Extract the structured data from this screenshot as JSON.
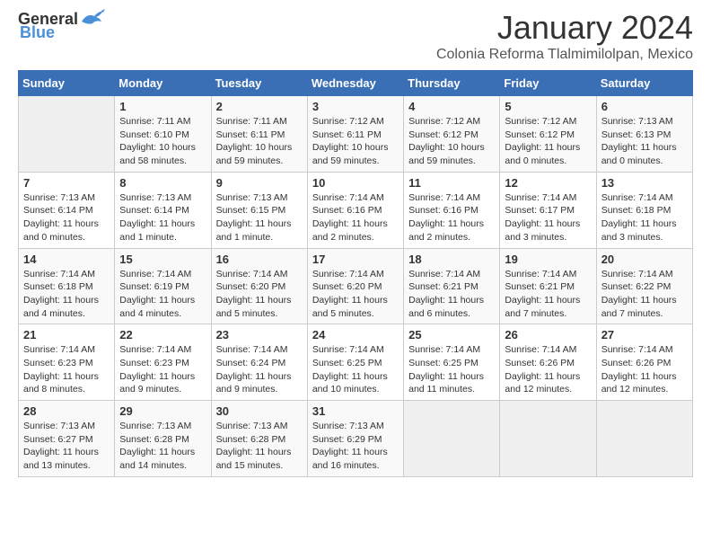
{
  "header": {
    "logo_general": "General",
    "logo_blue": "Blue",
    "title": "January 2024",
    "subtitle": "Colonia Reforma Tlalmimilolpan, Mexico"
  },
  "days_of_week": [
    "Sunday",
    "Monday",
    "Tuesday",
    "Wednesday",
    "Thursday",
    "Friday",
    "Saturday"
  ],
  "weeks": [
    [
      {
        "day": "",
        "info": ""
      },
      {
        "day": "1",
        "info": "Sunrise: 7:11 AM\nSunset: 6:10 PM\nDaylight: 10 hours\nand 58 minutes."
      },
      {
        "day": "2",
        "info": "Sunrise: 7:11 AM\nSunset: 6:11 PM\nDaylight: 10 hours\nand 59 minutes."
      },
      {
        "day": "3",
        "info": "Sunrise: 7:12 AM\nSunset: 6:11 PM\nDaylight: 10 hours\nand 59 minutes."
      },
      {
        "day": "4",
        "info": "Sunrise: 7:12 AM\nSunset: 6:12 PM\nDaylight: 10 hours\nand 59 minutes."
      },
      {
        "day": "5",
        "info": "Sunrise: 7:12 AM\nSunset: 6:12 PM\nDaylight: 11 hours\nand 0 minutes."
      },
      {
        "day": "6",
        "info": "Sunrise: 7:13 AM\nSunset: 6:13 PM\nDaylight: 11 hours\nand 0 minutes."
      }
    ],
    [
      {
        "day": "7",
        "info": "Sunrise: 7:13 AM\nSunset: 6:14 PM\nDaylight: 11 hours\nand 0 minutes."
      },
      {
        "day": "8",
        "info": "Sunrise: 7:13 AM\nSunset: 6:14 PM\nDaylight: 11 hours\nand 1 minute."
      },
      {
        "day": "9",
        "info": "Sunrise: 7:13 AM\nSunset: 6:15 PM\nDaylight: 11 hours\nand 1 minute."
      },
      {
        "day": "10",
        "info": "Sunrise: 7:14 AM\nSunset: 6:16 PM\nDaylight: 11 hours\nand 2 minutes."
      },
      {
        "day": "11",
        "info": "Sunrise: 7:14 AM\nSunset: 6:16 PM\nDaylight: 11 hours\nand 2 minutes."
      },
      {
        "day": "12",
        "info": "Sunrise: 7:14 AM\nSunset: 6:17 PM\nDaylight: 11 hours\nand 3 minutes."
      },
      {
        "day": "13",
        "info": "Sunrise: 7:14 AM\nSunset: 6:18 PM\nDaylight: 11 hours\nand 3 minutes."
      }
    ],
    [
      {
        "day": "14",
        "info": "Sunrise: 7:14 AM\nSunset: 6:18 PM\nDaylight: 11 hours\nand 4 minutes."
      },
      {
        "day": "15",
        "info": "Sunrise: 7:14 AM\nSunset: 6:19 PM\nDaylight: 11 hours\nand 4 minutes."
      },
      {
        "day": "16",
        "info": "Sunrise: 7:14 AM\nSunset: 6:20 PM\nDaylight: 11 hours\nand 5 minutes."
      },
      {
        "day": "17",
        "info": "Sunrise: 7:14 AM\nSunset: 6:20 PM\nDaylight: 11 hours\nand 5 minutes."
      },
      {
        "day": "18",
        "info": "Sunrise: 7:14 AM\nSunset: 6:21 PM\nDaylight: 11 hours\nand 6 minutes."
      },
      {
        "day": "19",
        "info": "Sunrise: 7:14 AM\nSunset: 6:21 PM\nDaylight: 11 hours\nand 7 minutes."
      },
      {
        "day": "20",
        "info": "Sunrise: 7:14 AM\nSunset: 6:22 PM\nDaylight: 11 hours\nand 7 minutes."
      }
    ],
    [
      {
        "day": "21",
        "info": "Sunrise: 7:14 AM\nSunset: 6:23 PM\nDaylight: 11 hours\nand 8 minutes."
      },
      {
        "day": "22",
        "info": "Sunrise: 7:14 AM\nSunset: 6:23 PM\nDaylight: 11 hours\nand 9 minutes."
      },
      {
        "day": "23",
        "info": "Sunrise: 7:14 AM\nSunset: 6:24 PM\nDaylight: 11 hours\nand 9 minutes."
      },
      {
        "day": "24",
        "info": "Sunrise: 7:14 AM\nSunset: 6:25 PM\nDaylight: 11 hours\nand 10 minutes."
      },
      {
        "day": "25",
        "info": "Sunrise: 7:14 AM\nSunset: 6:25 PM\nDaylight: 11 hours\nand 11 minutes."
      },
      {
        "day": "26",
        "info": "Sunrise: 7:14 AM\nSunset: 6:26 PM\nDaylight: 11 hours\nand 12 minutes."
      },
      {
        "day": "27",
        "info": "Sunrise: 7:14 AM\nSunset: 6:26 PM\nDaylight: 11 hours\nand 12 minutes."
      }
    ],
    [
      {
        "day": "28",
        "info": "Sunrise: 7:13 AM\nSunset: 6:27 PM\nDaylight: 11 hours\nand 13 minutes."
      },
      {
        "day": "29",
        "info": "Sunrise: 7:13 AM\nSunset: 6:28 PM\nDaylight: 11 hours\nand 14 minutes."
      },
      {
        "day": "30",
        "info": "Sunrise: 7:13 AM\nSunset: 6:28 PM\nDaylight: 11 hours\nand 15 minutes."
      },
      {
        "day": "31",
        "info": "Sunrise: 7:13 AM\nSunset: 6:29 PM\nDaylight: 11 hours\nand 16 minutes."
      },
      {
        "day": "",
        "info": ""
      },
      {
        "day": "",
        "info": ""
      },
      {
        "day": "",
        "info": ""
      }
    ]
  ]
}
